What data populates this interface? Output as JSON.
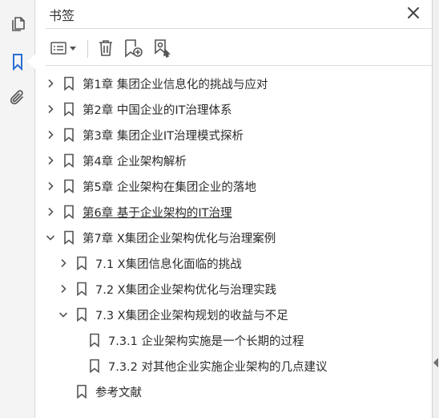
{
  "panel": {
    "title": "书签",
    "close_icon": "close-icon"
  },
  "rail": {
    "icons": [
      "copy-pages-icon",
      "bookmark-icon",
      "attachment-paperclip-icon"
    ],
    "active": "bookmark-icon"
  },
  "toolbar": {
    "icons": [
      "options-menu-icon",
      "chevron-down-icon",
      "trash-icon",
      "new-bookmark-icon",
      "bookmark-from-selection-icon"
    ]
  },
  "bookmarks": [
    {
      "label": "第1章 集团企业信息化的挑战与应对",
      "level": 0,
      "state": "collapsed"
    },
    {
      "label": "第2章 中国企业的IT治理体系",
      "level": 0,
      "state": "collapsed"
    },
    {
      "label": "第3章 集团企业IT治理模式探析",
      "level": 0,
      "state": "collapsed"
    },
    {
      "label": "第4章 企业架构解析",
      "level": 0,
      "state": "collapsed"
    },
    {
      "label": "第5章 企业架构在集团企业的落地",
      "level": 0,
      "state": "collapsed"
    },
    {
      "label": "第6章 基于企业架构的IT治理",
      "level": 0,
      "state": "collapsed",
      "underlined": true
    },
    {
      "label": "第7章 X集团企业架构优化与治理案例",
      "level": 0,
      "state": "expanded"
    },
    {
      "label": "7.1 X集团信息化面临的挑战",
      "level": 1,
      "state": "collapsed"
    },
    {
      "label": "7.2 X集团企业架构优化与治理实践",
      "level": 1,
      "state": "collapsed"
    },
    {
      "label": "7.3 X集团企业架构规划的收益与不足",
      "level": 1,
      "state": "expanded"
    },
    {
      "label": "7.3.1 企业架构实施是一个长期的过程",
      "level": 2,
      "state": "leaf"
    },
    {
      "label": "7.3.2 对其他企业实施企业架构的几点建议",
      "level": 2,
      "state": "leaf"
    },
    {
      "label": "参考文献",
      "level": 1,
      "state": "leaf"
    }
  ],
  "colors": {
    "accent": "#2a6fd6",
    "icon": "#555555",
    "text": "#2b2b2b"
  }
}
